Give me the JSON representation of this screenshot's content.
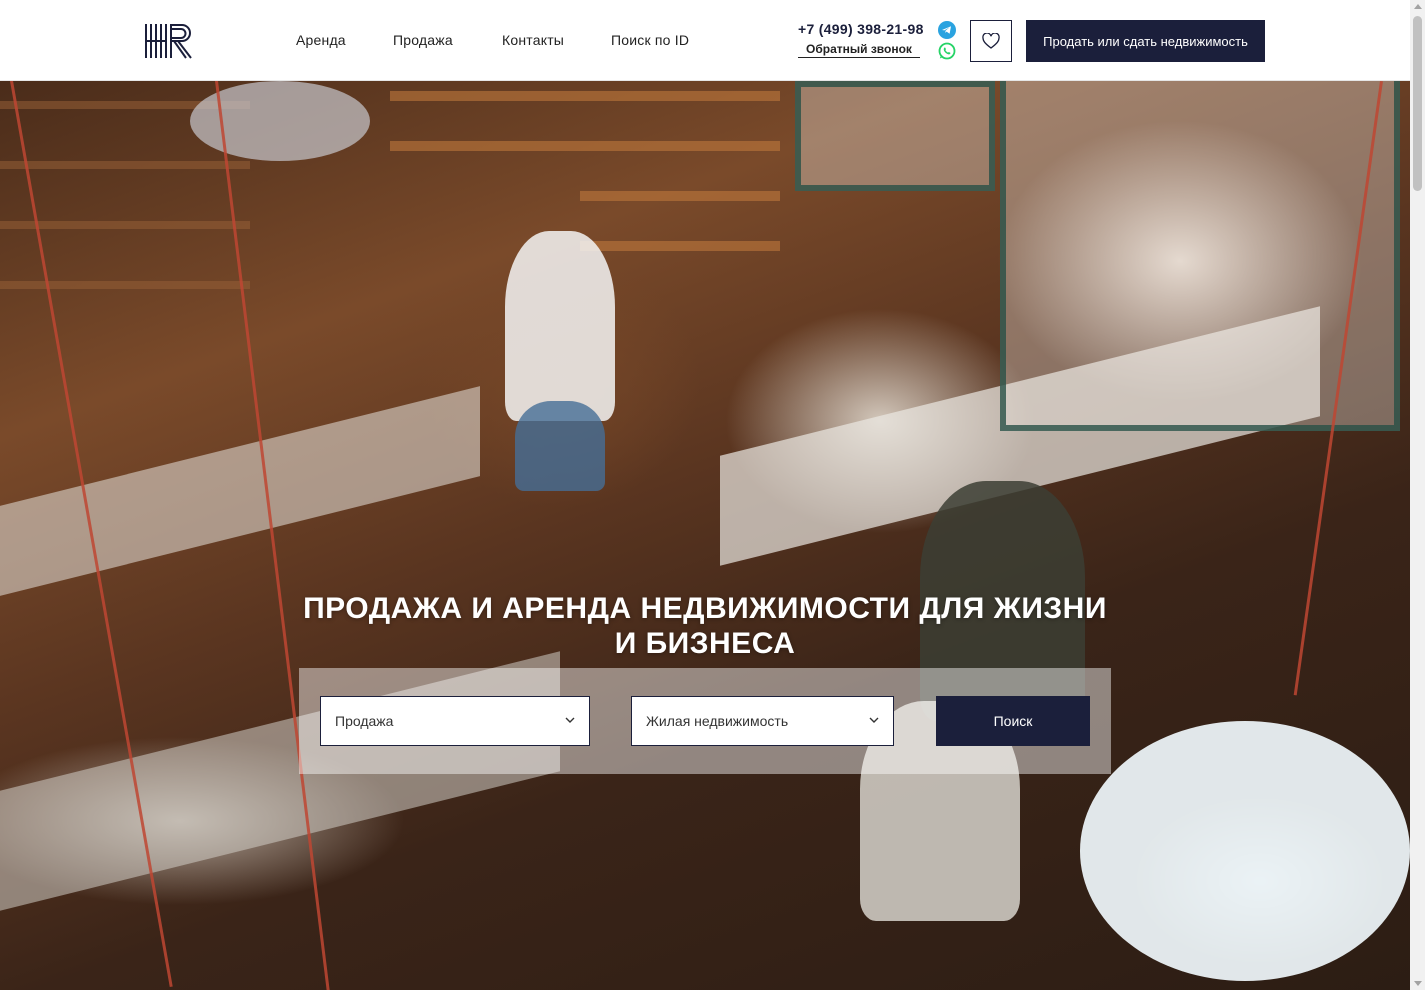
{
  "header": {
    "logo_text": "HR",
    "nav": [
      {
        "label": "Аренда"
      },
      {
        "label": "Продажа"
      },
      {
        "label": "Контакты"
      },
      {
        "label": "Поиск по ID"
      }
    ],
    "phone": "+7 (499) 398-21-98",
    "callback_label": "Обратный звонок",
    "messengers": [
      "telegram-icon",
      "whatsapp-icon"
    ],
    "favorites_icon": "heart-icon",
    "cta_label": "Продать или сдать недвижимость"
  },
  "hero": {
    "title": "Продажа и аренда недвижимости для жизни и бизнеса",
    "deal_type_value": "Продажа",
    "property_type_value": "Жилая недвижимость",
    "search_label": "Поиск"
  },
  "colors": {
    "brand_dark": "#1b1f3b",
    "telegram": "#2aa3e0",
    "whatsapp": "#25d366"
  }
}
